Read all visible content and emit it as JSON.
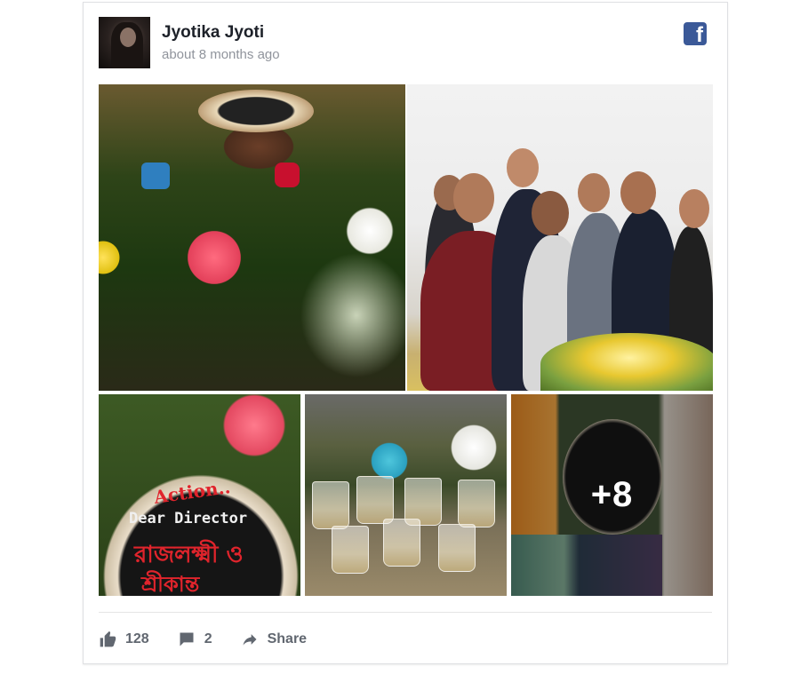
{
  "post": {
    "author": "Jyotika Jyoti",
    "timestamp": "about 8 months ago",
    "platform_icon": "facebook-icon",
    "more_photos": "+8",
    "cake_text": {
      "line1": "Action..",
      "line2": "Dear Director",
      "line3": "রাজলক্ষ্মী ও",
      "line4": "শ্রীকান্ত"
    }
  },
  "actions": {
    "likes_count": "128",
    "comments_count": "2",
    "share_label": "Share"
  },
  "colors": {
    "facebook_blue": "#3b5998",
    "action_grey": "#616770",
    "timestamp_grey": "#90949c"
  }
}
